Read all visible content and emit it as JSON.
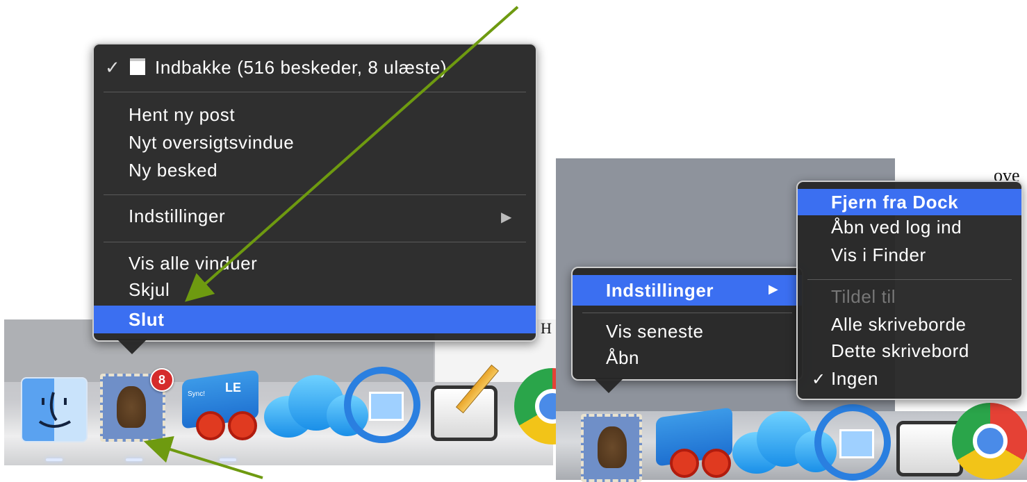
{
  "left_menu": {
    "window_item": "Indbakke (516 beskeder, 8 ulæste)",
    "window_checked": "✓",
    "group2": [
      "Hent ny post",
      "Nyt oversigtsvindue",
      "Ny besked"
    ],
    "options": "Indstillinger",
    "submenu_arrow": "▶",
    "group4": [
      "Vis alle vinduer",
      "Skjul"
    ],
    "quit": "Slut"
  },
  "right_menu": {
    "options": "Indstillinger",
    "submenu_arrow": "▶",
    "items": [
      "Vis seneste",
      "Åbn"
    ]
  },
  "right_submenu": {
    "items": [
      "Fjern fra Dock",
      "Åbn ved log ind",
      "Vis i Finder"
    ],
    "assign_heading": "Tildel til",
    "assign_items": [
      "Alle skriveborde",
      "Dette skrivebord",
      "Ingen"
    ],
    "checkmark": "✓"
  },
  "dock": {
    "mail_badge": "8",
    "sync_label": "LE",
    "sync_tag": "Sync!"
  },
  "background_text": {
    "left_fragment": "H",
    "right_fragment": "ove"
  },
  "icons": {
    "left_dock": [
      "finder-icon",
      "mail-icon",
      "sync-icon",
      "icloud-icon",
      "airplay-icon",
      "feedback-icon",
      "chrome-icon"
    ],
    "right_dock": [
      "mail-icon",
      "sync-icon",
      "icloud-icon",
      "airplay-icon",
      "feedback-icon",
      "chrome-icon"
    ]
  },
  "colors": {
    "menu_bg": "#262626",
    "highlight": "#3b6ff1",
    "annotation_arrow": "#6e9a10",
    "badge": "#d52b2b"
  }
}
